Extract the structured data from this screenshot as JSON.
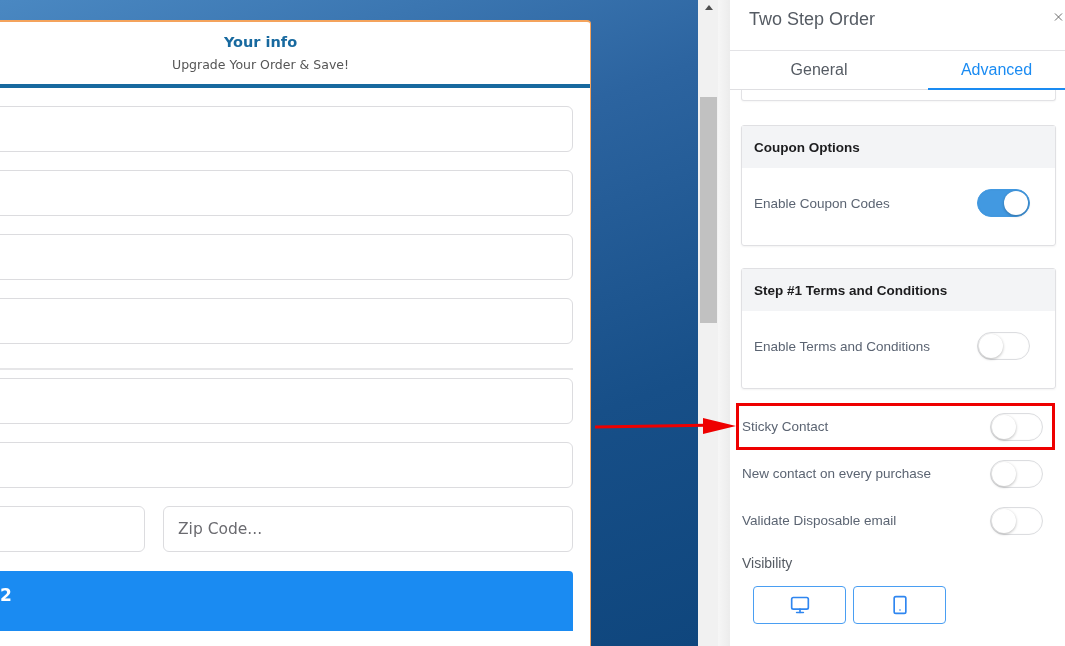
{
  "form_card": {
    "title": "Your info",
    "subtitle": "Upgrade Your Order & Save!",
    "rows": [
      {
        "kind": "field"
      },
      {
        "kind": "field"
      },
      {
        "kind": "field"
      },
      {
        "kind": "field"
      },
      {
        "kind": "divider"
      },
      {
        "kind": "field"
      },
      {
        "kind": "field"
      },
      {
        "kind": "split",
        "fields": [
          {
            "kind": "field"
          },
          {
            "kind": "field",
            "placeholder": "Zip Code..."
          }
        ]
      }
    ],
    "submit_button": {
      "label": "2"
    }
  },
  "panel": {
    "title": "Two Step Order",
    "tabs": [
      {
        "label": "General",
        "selected": false
      },
      {
        "label": "Advanced",
        "selected": true
      }
    ],
    "sections": [
      {
        "title": "Coupon Options",
        "options": [
          {
            "label": "Enable Coupon Codes",
            "on": true
          }
        ]
      },
      {
        "title": "Step #1 Terms and Conditions",
        "options": [
          {
            "label": "Enable Terms and Conditions",
            "on": false
          }
        ]
      }
    ],
    "options": [
      {
        "label": "Sticky Contact",
        "on": false,
        "highlighted": true
      },
      {
        "label": "New contact on every purchase",
        "on": false,
        "highlighted": false
      },
      {
        "label": "Validate Disposable email",
        "on": false,
        "highlighted": false
      }
    ],
    "visibility": {
      "label": "Visibility",
      "devices": [
        {
          "kind": "desktop"
        },
        {
          "kind": "mobile"
        }
      ]
    }
  }
}
